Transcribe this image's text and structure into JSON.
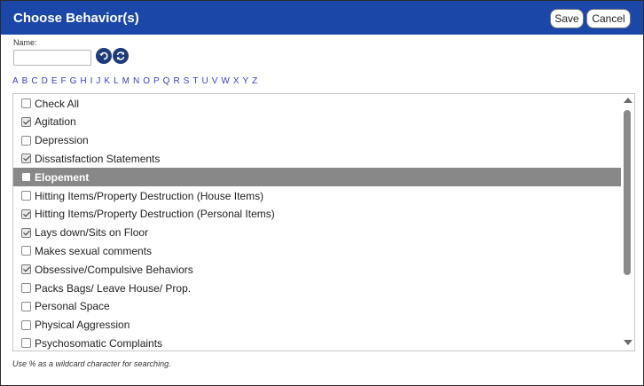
{
  "dialog": {
    "title": "Choose Behavior(s)"
  },
  "toolbar": {
    "save_label": "Save",
    "cancel_label": "Cancel"
  },
  "search": {
    "label": "Name:",
    "value": "",
    "placeholder": ""
  },
  "alphabet": [
    "A",
    "B",
    "C",
    "D",
    "E",
    "F",
    "G",
    "H",
    "I",
    "J",
    "K",
    "L",
    "M",
    "N",
    "O",
    "P",
    "Q",
    "R",
    "S",
    "T",
    "U",
    "V",
    "W",
    "X",
    "Y",
    "Z"
  ],
  "list": {
    "items": [
      {
        "label": "Check All",
        "checked": false,
        "selected": false
      },
      {
        "label": "Agitation",
        "checked": true,
        "selected": false
      },
      {
        "label": "Depression",
        "checked": false,
        "selected": false
      },
      {
        "label": "Dissatisfaction Statements",
        "checked": true,
        "selected": false
      },
      {
        "label": "Elopement",
        "checked": false,
        "selected": true
      },
      {
        "label": "Hitting Items/Property Destruction (House Items)",
        "checked": false,
        "selected": false
      },
      {
        "label": "Hitting Items/Property Destruction (Personal Items)",
        "checked": true,
        "selected": false
      },
      {
        "label": "Lays down/Sits on Floor",
        "checked": true,
        "selected": false
      },
      {
        "label": "Makes sexual comments",
        "checked": false,
        "selected": false
      },
      {
        "label": "Obsessive/Compulsive Behaviors",
        "checked": true,
        "selected": false
      },
      {
        "label": "Packs Bags/ Leave House/ Prop.",
        "checked": false,
        "selected": false
      },
      {
        "label": "Personal Space",
        "checked": false,
        "selected": false
      },
      {
        "label": "Physical Aggression",
        "checked": false,
        "selected": false
      },
      {
        "label": "Psychosomatic Complaints",
        "checked": false,
        "selected": false
      }
    ]
  },
  "footer": {
    "hint": "Use % as a wildcard character for searching."
  }
}
